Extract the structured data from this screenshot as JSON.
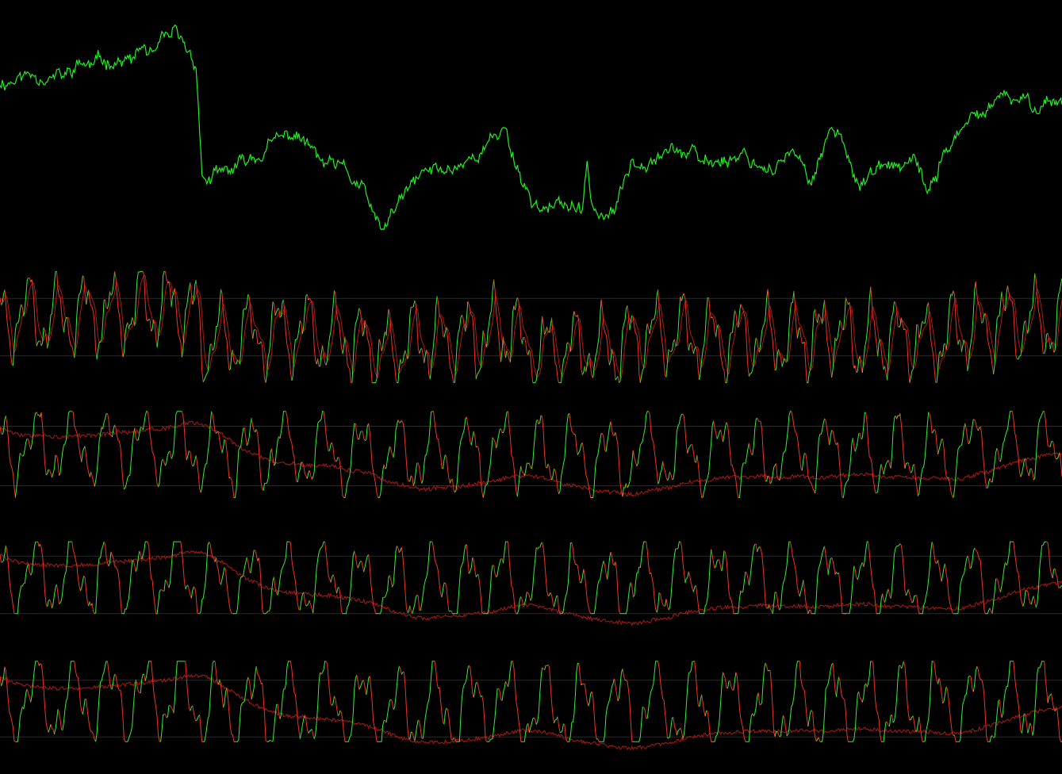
{
  "colors": {
    "background": "#000000",
    "price": "#22ee22",
    "up": "#33ee33",
    "down": "#ee3322",
    "slow": "#b01a10",
    "guide": "#2a2a2a"
  },
  "chart_data": [
    {
      "type": "line",
      "panel": "price",
      "title": "",
      "xlabel": "",
      "ylabel": "",
      "grid": false,
      "legend": "none",
      "ylim": [
        0,
        100
      ],
      "series": [
        {
          "knots": [
            [
              0,
              70
            ],
            [
              2,
              72
            ],
            [
              4,
              74
            ],
            [
              6,
              71
            ],
            [
              7.5,
              77
            ],
            [
              9,
              76
            ],
            [
              10.5,
              80
            ],
            [
              12.5,
              78
            ],
            [
              13.5,
              84
            ],
            [
              14.5,
              79
            ],
            [
              15.5,
              85
            ],
            [
              16.5,
              88
            ],
            [
              17,
              85
            ],
            [
              18,
              80
            ],
            [
              18.5,
              78
            ],
            [
              19,
              32
            ],
            [
              20,
              30
            ],
            [
              22.5,
              35
            ],
            [
              25.5,
              44
            ],
            [
              28,
              49
            ],
            [
              30.5,
              36
            ],
            [
              32,
              34
            ],
            [
              34,
              27
            ],
            [
              35.8,
              8
            ],
            [
              38,
              23
            ],
            [
              40,
              33
            ],
            [
              42,
              34
            ],
            [
              44,
              39
            ],
            [
              46,
              44
            ],
            [
              47.5,
              52
            ],
            [
              48.5,
              38
            ],
            [
              50,
              22
            ],
            [
              52,
              18
            ],
            [
              54,
              20
            ],
            [
              54.8,
              14
            ],
            [
              55.3,
              36
            ],
            [
              55.8,
              20
            ],
            [
              57,
              14
            ],
            [
              58,
              18
            ],
            [
              59.5,
              38
            ],
            [
              62,
              43
            ],
            [
              64,
              43
            ],
            [
              66,
              36
            ],
            [
              68,
              39
            ],
            [
              70,
              41
            ],
            [
              72,
              36
            ],
            [
              74,
              38
            ],
            [
              75,
              39
            ],
            [
              76,
              29
            ],
            [
              77.5,
              42
            ],
            [
              78,
              52
            ],
            [
              79.5,
              45
            ],
            [
              81,
              29
            ],
            [
              83,
              34
            ],
            [
              85,
              35
            ],
            [
              86,
              36
            ],
            [
              87.5,
              24
            ],
            [
              89,
              43
            ],
            [
              91.5,
              53
            ],
            [
              93.5,
              61
            ],
            [
              95,
              62
            ],
            [
              97,
              61
            ],
            [
              99,
              63
            ],
            [
              100,
              62
            ]
          ],
          "noise": 4,
          "seed": 11
        }
      ]
    },
    {
      "type": "line",
      "panel": "oscillator-1",
      "title": "",
      "xlabel": "",
      "ylabel": "",
      "grid": false,
      "legend": "none",
      "ylim": [
        -10,
        110
      ],
      "levels": [
        80,
        20
      ],
      "series": [
        {
          "role": "fast",
          "period": 1.6,
          "amplitude": 32,
          "level": 48,
          "follow": 0.55,
          "clip": [
            -8,
            108
          ],
          "seed": 21
        },
        {
          "role": "slow",
          "smoothing": 0.35,
          "lag": 1
        }
      ]
    },
    {
      "type": "line",
      "panel": "oscillator-2",
      "title": "",
      "xlabel": "",
      "ylabel": "",
      "grid": false,
      "legend": "none",
      "ylim": [
        -10,
        110
      ],
      "levels": [
        80,
        20
      ],
      "series": [
        {
          "role": "fast",
          "period": 2.1,
          "amplitude": 30,
          "level": 55,
          "follow": 0.15,
          "clip": [
            8,
            95
          ],
          "seed": 33
        },
        {
          "role": "slow",
          "smoothing": 0.05,
          "lag": 3,
          "trend": 0.9
        }
      ]
    },
    {
      "type": "line",
      "panel": "oscillator-3",
      "title": "",
      "xlabel": "",
      "ylabel": "",
      "grid": false,
      "legend": "none",
      "ylim": [
        -10,
        110
      ],
      "levels": [
        80,
        20
      ],
      "series": [
        {
          "role": "fast",
          "period": 2.1,
          "amplitude": 32,
          "level": 55,
          "follow": 0.15,
          "clip": [
            20,
            95
          ],
          "seed": 45
        },
        {
          "role": "slow",
          "smoothing": 0.045,
          "lag": 3,
          "trend": 0.95
        }
      ]
    },
    {
      "type": "line",
      "panel": "oscillator-4",
      "title": "",
      "xlabel": "",
      "ylabel": "",
      "grid": false,
      "legend": "none",
      "ylim": [
        -10,
        110
      ],
      "levels": [
        80,
        20
      ],
      "series": [
        {
          "role": "fast",
          "period": 2.1,
          "amplitude": 36,
          "level": 55,
          "follow": 0.15,
          "clip": [
            15,
            100
          ],
          "seed": 57
        },
        {
          "role": "slow",
          "smoothing": 0.04,
          "lag": 3,
          "trend": 1.0
        }
      ]
    }
  ]
}
